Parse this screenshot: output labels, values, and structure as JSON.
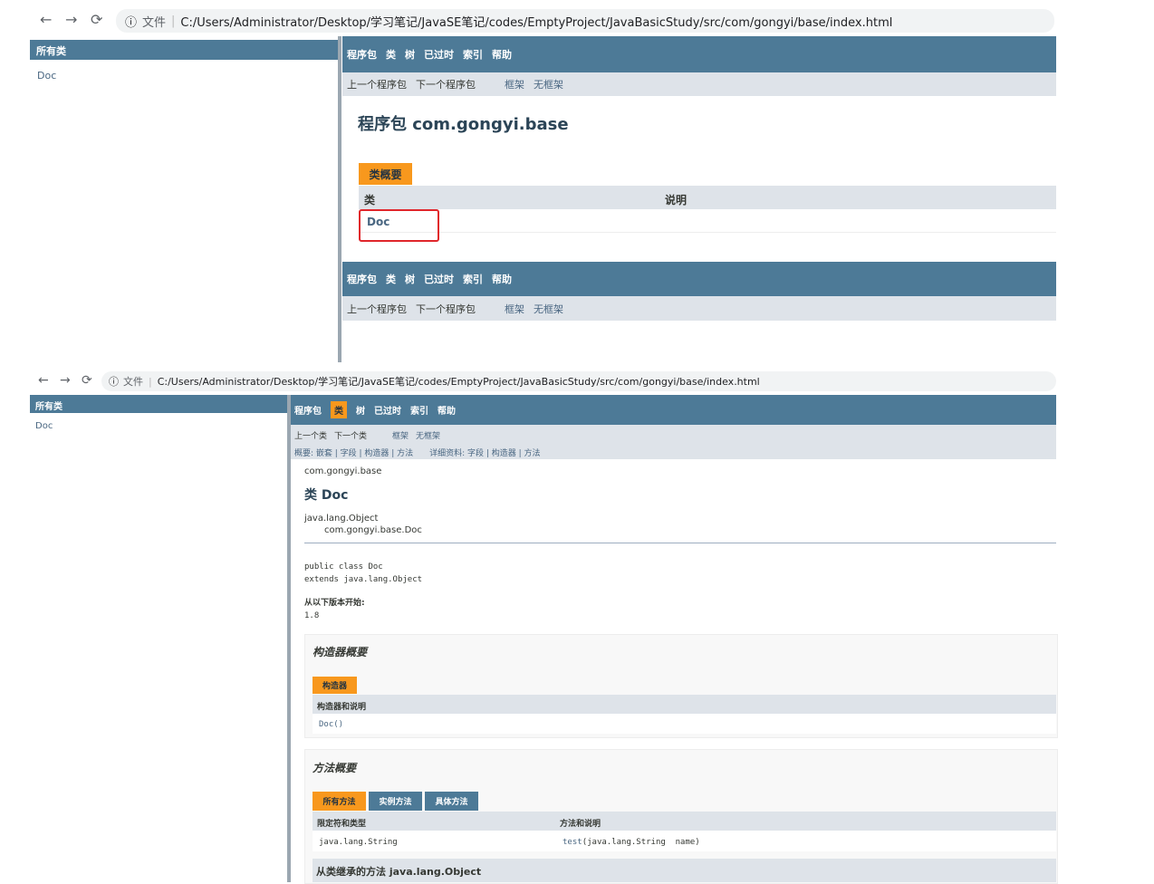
{
  "top": {
    "address": {
      "file_label": "文件",
      "url": "C:/Users/Administrator/Desktop/学习笔记/JavaSE笔记/codes/EmptyProject/JavaBasicStudy/src/com/gongyi/base/index.html"
    },
    "left": {
      "header": "所有类",
      "item": "Doc"
    },
    "nav": [
      "程序包",
      "类",
      "树",
      "已过时",
      "索引",
      "帮助"
    ],
    "subnav": {
      "prev": "上一个程序包",
      "next": "下一个程序包",
      "frames": "框架",
      "noframes": "无框架"
    },
    "title": "程序包 com.gongyi.base",
    "summary_tab": "类概要",
    "col_class": "类",
    "col_desc": "说明",
    "row_class": "Doc"
  },
  "bottom": {
    "address": {
      "file_label": "文件",
      "url": "C:/Users/Administrator/Desktop/学习笔记/JavaSE笔记/codes/EmptyProject/JavaBasicStudy/src/com/gongyi/base/index.html"
    },
    "left": {
      "header": "所有类",
      "item": "Doc"
    },
    "nav": [
      "程序包",
      "类",
      "树",
      "已过时",
      "索引",
      "帮助"
    ],
    "subnav": {
      "prev": "上一个类",
      "next": "下一个类",
      "frames": "框架",
      "noframes": "无框架"
    },
    "summary_line": "概要: 嵌套 | 字段 | 构造器 | 方法",
    "detail_line": "详细资料: 字段 | 构造器 | 方法",
    "package": "com.gongyi.base",
    "title": "类 Doc",
    "hierarchy_root": "java.lang.Object",
    "hierarchy_child": "com.gongyi.base.Doc",
    "signature_line1": "public class Doc",
    "signature_line2": "extends java.lang.Object",
    "since_label": "从以下版本开始:",
    "since_value": "1.8",
    "constructor_summary": "构造器概要",
    "constructor_tab": "构造器",
    "constructor_header": "构造器和说明",
    "constructor_row": "Doc()",
    "method_summary": "方法概要",
    "method_tabs": [
      "所有方法",
      "实例方法",
      "具体方法"
    ],
    "method_col_type": "限定符和类型",
    "method_col_desc": "方法和说明",
    "method_row_type": "java.lang.String",
    "method_row_name": "test",
    "method_row_params": "(java.lang.String  name)",
    "inherited_title": "从类继承的方法 java.lang.Object"
  }
}
